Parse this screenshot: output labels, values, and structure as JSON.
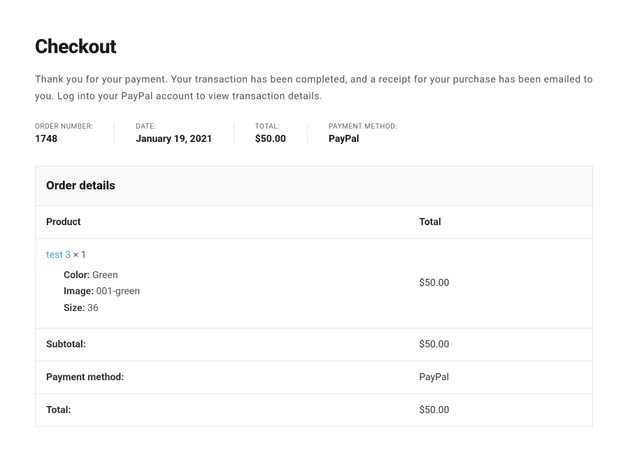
{
  "page_title": "Checkout",
  "thankyou_message": "Thank you for your payment. Your transaction has been completed, and a receipt for your purchase has been emailed to you. Log into your PayPal account to view transaction details.",
  "overview": {
    "order_number": {
      "label": "ORDER NUMBER:",
      "value": "1748"
    },
    "date": {
      "label": "DATE:",
      "value": "January 19, 2021"
    },
    "total": {
      "label": "TOTAL:",
      "value": "$50.00"
    },
    "payment_method": {
      "label": "PAYMENT METHOD:",
      "value": "PayPal"
    }
  },
  "order_details": {
    "heading": "Order details",
    "columns": {
      "product": "Product",
      "total": "Total"
    },
    "item": {
      "name": "test 3",
      "qty_separator": " × ",
      "qty": "1",
      "total": "$50.00",
      "variations": [
        {
          "label": "Color:",
          "value": "Green"
        },
        {
          "label": "Image:",
          "value": "001-green"
        },
        {
          "label": "Size:",
          "value": "36"
        }
      ]
    },
    "footer": {
      "subtotal": {
        "label": "Subtotal:",
        "value": "$50.00"
      },
      "payment_method": {
        "label": "Payment method:",
        "value": "PayPal"
      },
      "total": {
        "label": "Total:",
        "value": "$50.00"
      }
    }
  }
}
